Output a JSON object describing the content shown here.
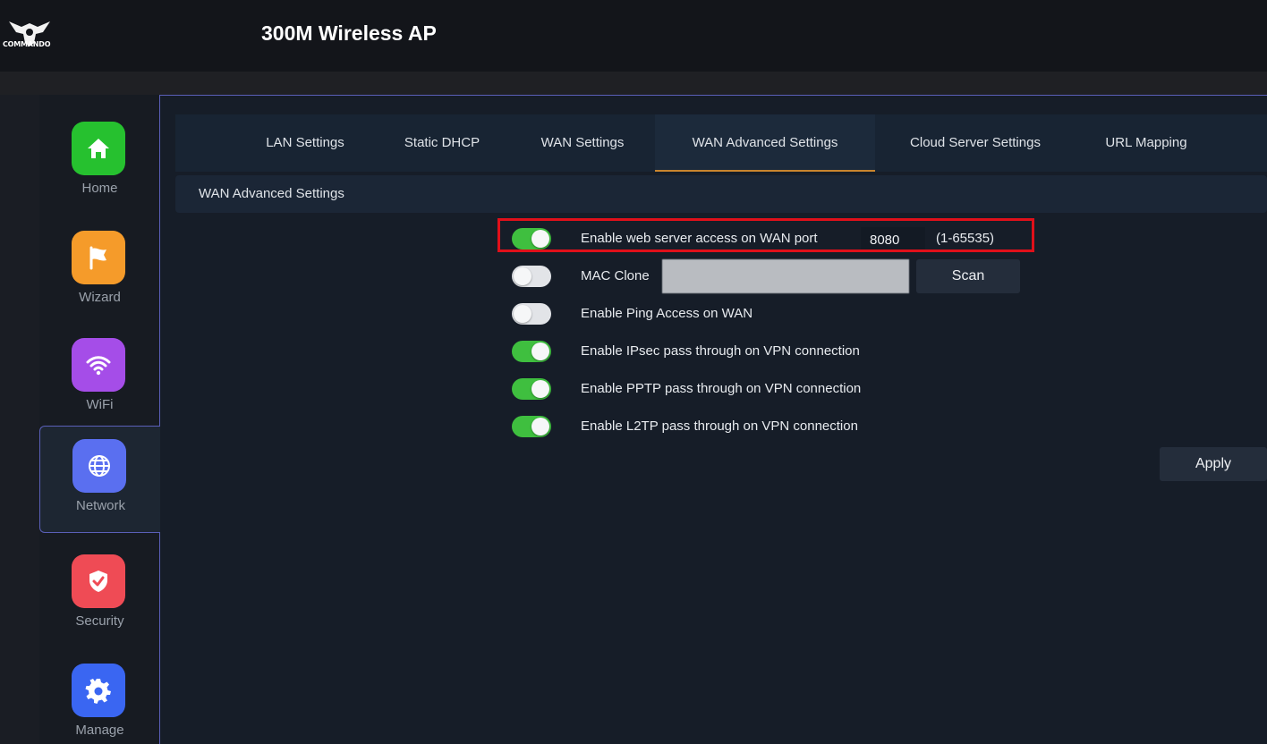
{
  "header": {
    "logo_text": "COMMANDO",
    "title": "300M Wireless AP"
  },
  "sidebar": {
    "items": [
      {
        "label": "Home",
        "icon": "home-icon",
        "color": "#26c12f"
      },
      {
        "label": "Wizard",
        "icon": "flag-icon",
        "color": "#f59b2a"
      },
      {
        "label": "WiFi",
        "icon": "wifi-icon",
        "color": "#a54de8"
      },
      {
        "label": "Network",
        "icon": "globe-icon",
        "color": "#5a6ff0",
        "active": true
      },
      {
        "label": "Security",
        "icon": "shield-icon",
        "color": "#ef4b55"
      },
      {
        "label": "Manage",
        "icon": "gear-icon",
        "color": "#3a66f2"
      }
    ]
  },
  "tabs": [
    {
      "label": "LAN Settings"
    },
    {
      "label": "Static DHCP"
    },
    {
      "label": "WAN Settings"
    },
    {
      "label": "WAN Advanced Settings",
      "active": true
    },
    {
      "label": "Cloud Server Settings"
    },
    {
      "label": "URL Mapping"
    }
  ],
  "section": {
    "title": "WAN Advanced Settings"
  },
  "settings": {
    "web_server": {
      "label": "Enable web server access on WAN port",
      "enabled": true,
      "port_value": "8080",
      "range": "(1-65535)"
    },
    "mac_clone": {
      "label": "MAC Clone",
      "enabled": false,
      "value": "",
      "scan_label": "Scan"
    },
    "ping": {
      "label": "Enable Ping Access on WAN",
      "enabled": false
    },
    "ipsec": {
      "label": "Enable IPsec pass through on VPN connection",
      "enabled": true
    },
    "pptp": {
      "label": "Enable PPTP pass through on VPN connection",
      "enabled": true
    },
    "l2tp": {
      "label": "Enable L2TP pass through on VPN connection",
      "enabled": true
    }
  },
  "actions": {
    "apply_label": "Apply"
  },
  "colors": {
    "accent": "#c9852e",
    "toggle_on": "#3fbf3f",
    "highlight": "#e0101a"
  }
}
